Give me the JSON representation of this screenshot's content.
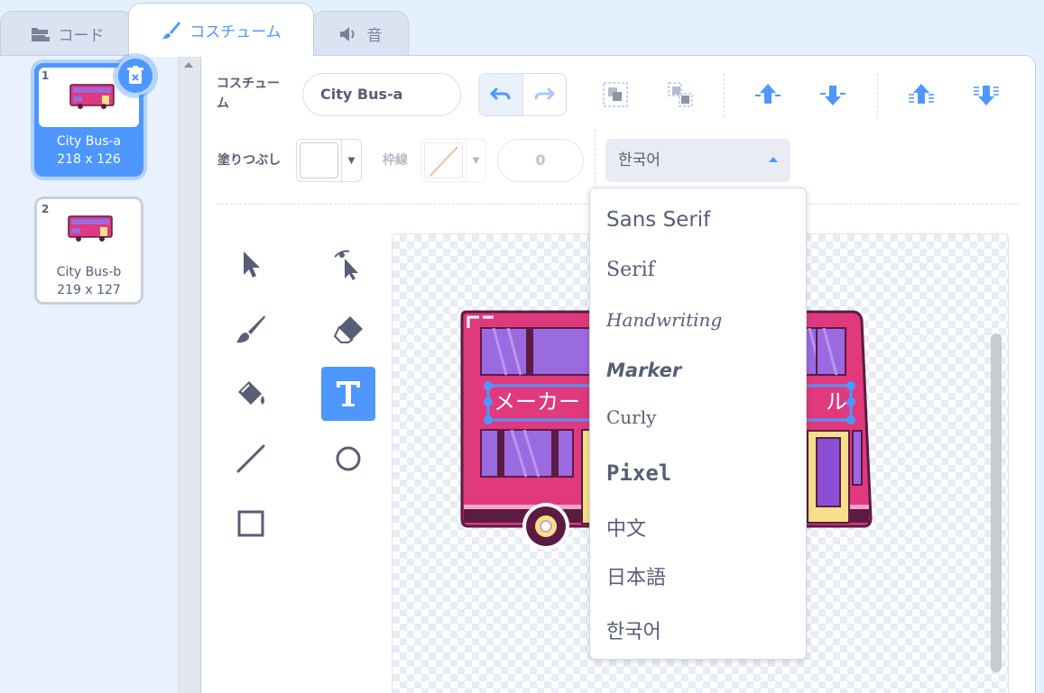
{
  "tabs": {
    "code": "コード",
    "costumes": "コスチューム",
    "sounds": "音"
  },
  "costume_list": [
    {
      "number": "1",
      "name": "City Bus-a",
      "size": "218 x 126",
      "selected": true
    },
    {
      "number": "2",
      "name": "City Bus-b",
      "size": "219 x 127",
      "selected": false
    }
  ],
  "toolbar": {
    "costume_label": "コスチューム",
    "costume_name": "City Bus-a",
    "fill_label": "塗りつぶし",
    "outline_label": "枠線",
    "outline_width": "0",
    "font_selected": "한국어"
  },
  "font_menu": {
    "options": [
      "Sans Serif",
      "Serif",
      "Handwriting",
      "Marker",
      "Curly",
      "Pixel",
      "中文",
      "日本語",
      "한국어"
    ]
  },
  "canvas": {
    "text_object": "メーカー",
    "text_object_end": "ル"
  },
  "colors": {
    "accent": "#4d97ff",
    "bus_body": "#e0397d",
    "bus_window": "#9a6ae0",
    "bus_trim": "#5c1b43"
  }
}
